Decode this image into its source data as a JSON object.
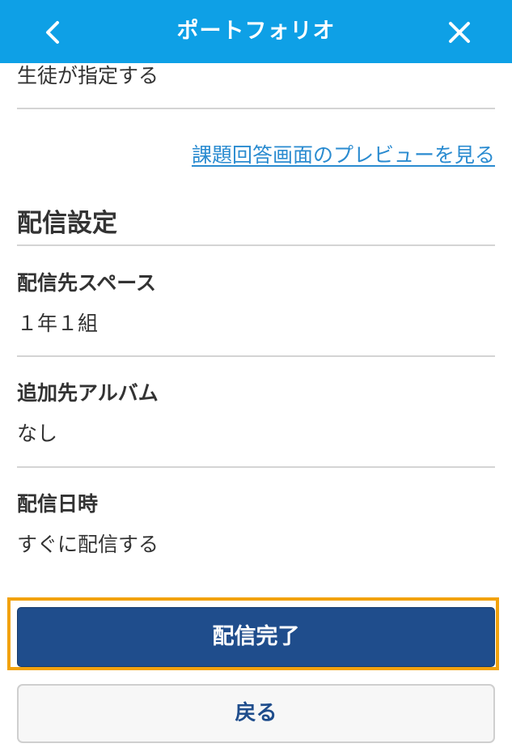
{
  "header": {
    "title": "ポートフォリオ",
    "back_icon": "chevron-left-icon",
    "close_icon": "close-icon",
    "background_color": "#0ea0e6"
  },
  "content": {
    "top_text": "生徒が指定する",
    "preview_link": "課題回答画面のプレビューを見る",
    "section_title": "配信設定",
    "fields": [
      {
        "label": "配信先スペース",
        "value": "１年１組"
      },
      {
        "label": "追加先アルバム",
        "value": "なし"
      },
      {
        "label": "配信日時",
        "value": "すぐに配信する"
      }
    ]
  },
  "buttons": {
    "primary_label": "配信完了",
    "secondary_label": "戻る",
    "primary_color": "#1f4d8c",
    "highlight_color": "#f2a20c"
  }
}
